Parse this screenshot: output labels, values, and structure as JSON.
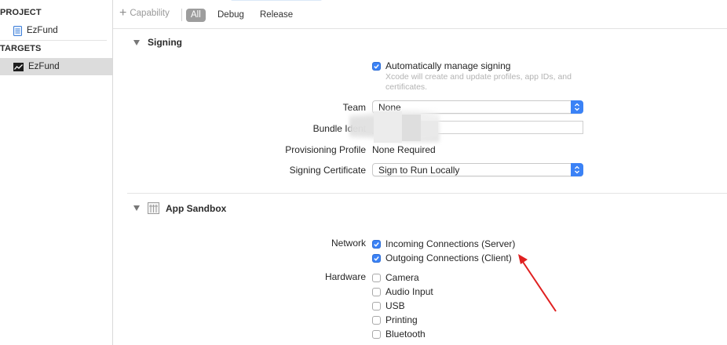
{
  "sidebar": {
    "project_heading": "PROJECT",
    "project_item": "EzFund",
    "targets_heading": "TARGETS",
    "target_item": "EzFund"
  },
  "toolbar": {
    "add_capability": "Capability",
    "segments": [
      "All",
      "Debug",
      "Release"
    ],
    "active_segment": "All"
  },
  "signing": {
    "title": "Signing",
    "auto_manage": {
      "label": "Automatically manage signing",
      "checked": true
    },
    "hint": "Xcode will create and update profiles, app IDs, and certificates.",
    "team": {
      "label": "Team",
      "value": "None"
    },
    "bundle_id": {
      "label": "Bundle Ident",
      "value": ""
    },
    "provisioning": {
      "label": "Provisioning Profile",
      "value": "None Required"
    },
    "certificate": {
      "label": "Signing Certificate",
      "value": "Sign to Run Locally"
    }
  },
  "sandbox": {
    "title": "App Sandbox",
    "network_label": "Network",
    "network": [
      {
        "label": "Incoming Connections (Server)",
        "checked": true
      },
      {
        "label": "Outgoing Connections (Client)",
        "checked": true
      }
    ],
    "hardware_label": "Hardware",
    "hardware": [
      {
        "label": "Camera",
        "checked": false
      },
      {
        "label": "Audio Input",
        "checked": false
      },
      {
        "label": "USB",
        "checked": false
      },
      {
        "label": "Printing",
        "checked": false
      },
      {
        "label": "Bluetooth",
        "checked": false
      }
    ]
  },
  "colors": {
    "accent": "#3b82f6",
    "annotation_arrow": "#e02020"
  }
}
